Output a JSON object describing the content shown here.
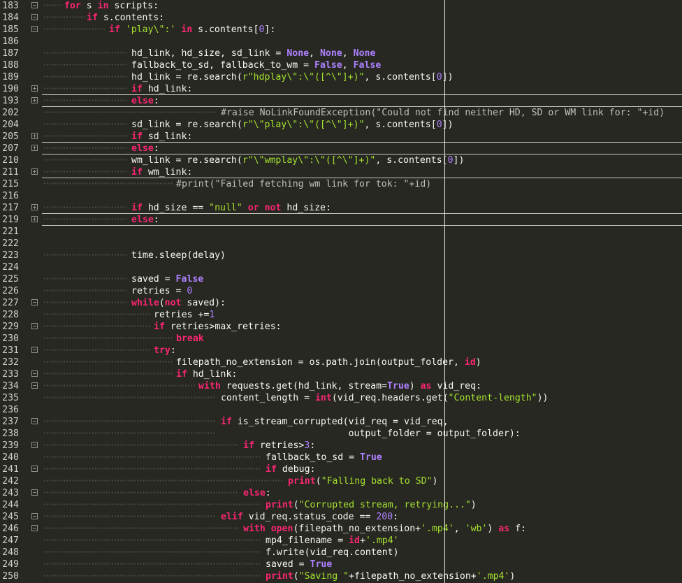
{
  "editor": {
    "ruler_column": 72,
    "lines": [
      {
        "n": "183",
        "fold": "minus",
        "indent": 1,
        "tokens": [
          [
            "for",
            "k"
          ],
          [
            " s ",
            ""
          ],
          [
            "in",
            "k"
          ],
          [
            " scripts:",
            ""
          ]
        ]
      },
      {
        "n": "184",
        "fold": "minus",
        "indent": 2,
        "tokens": [
          [
            "if",
            "k"
          ],
          [
            " s.contents:",
            ""
          ]
        ]
      },
      {
        "n": "185",
        "fold": "minus",
        "indent": 3,
        "tokens": [
          [
            "if",
            "k"
          ],
          [
            " ",
            ""
          ],
          [
            "'play\\\":'",
            "s"
          ],
          [
            " ",
            ""
          ],
          [
            "in",
            "k"
          ],
          [
            " s.contents[",
            ""
          ],
          [
            "0",
            "n"
          ],
          [
            "]:",
            ""
          ]
        ]
      },
      {
        "n": "186",
        "fold": "",
        "indent": 0,
        "tokens": []
      },
      {
        "n": "187",
        "fold": "",
        "indent": 4,
        "tokens": [
          [
            "hd_link, hd_size, sd_link = ",
            ""
          ],
          [
            "None",
            "b"
          ],
          [
            ", ",
            ""
          ],
          [
            "None",
            "b"
          ],
          [
            ", ",
            ""
          ],
          [
            "None",
            "b"
          ]
        ]
      },
      {
        "n": "188",
        "fold": "",
        "indent": 4,
        "tokens": [
          [
            "fallback_to_sd, fallback_to_wm = ",
            ""
          ],
          [
            "False",
            "b"
          ],
          [
            ", ",
            ""
          ],
          [
            "False",
            "b"
          ]
        ]
      },
      {
        "n": "189",
        "fold": "",
        "indent": 4,
        "tokens": [
          [
            "hd_link = re.search(",
            ""
          ],
          [
            "r\"hdplay\\\":\\\"([^\\\"]+)\"",
            "s"
          ],
          [
            ", s.contents[",
            ""
          ],
          [
            "0",
            "n"
          ],
          [
            "])",
            ""
          ]
        ]
      },
      {
        "n": "190",
        "fold": "plus",
        "indent": 4,
        "sep": true,
        "tokens": [
          [
            "if",
            "k"
          ],
          [
            " hd_link:",
            ""
          ]
        ]
      },
      {
        "n": "193",
        "fold": "plus",
        "indent": 4,
        "sep": true,
        "tokens": [
          [
            "else",
            "k"
          ],
          [
            ":",
            ""
          ]
        ]
      },
      {
        "n": "202",
        "fold": "",
        "indent": 8,
        "tokens": [
          [
            "#raise NoLinkFoundException(\"Could not find neither HD, SD or WM link for: \"+id)",
            "c"
          ]
        ]
      },
      {
        "n": "204",
        "fold": "",
        "indent": 4,
        "tokens": [
          [
            "sd_link = re.search(",
            ""
          ],
          [
            "r\"\\\"play\\\":\\\"([^\\\"]+)\"",
            "s"
          ],
          [
            ", s.contents[",
            ""
          ],
          [
            "0",
            "n"
          ],
          [
            "])",
            ""
          ]
        ]
      },
      {
        "n": "205",
        "fold": "plus",
        "indent": 4,
        "sep": true,
        "tokens": [
          [
            "if",
            "k"
          ],
          [
            " sd_link:",
            ""
          ]
        ]
      },
      {
        "n": "207",
        "fold": "plus",
        "indent": 4,
        "sep": true,
        "tokens": [
          [
            "else",
            "k"
          ],
          [
            ":",
            ""
          ]
        ]
      },
      {
        "n": "210",
        "fold": "",
        "indent": 4,
        "tokens": [
          [
            "wm_link = re.search(",
            ""
          ],
          [
            "r\"\\\"wmplay\\\":\\\"([^\\\"]+)\"",
            "s"
          ],
          [
            ", s.contents[",
            ""
          ],
          [
            "0",
            "n"
          ],
          [
            "])",
            ""
          ]
        ]
      },
      {
        "n": "211",
        "fold": "plus",
        "indent": 4,
        "sep": true,
        "tokens": [
          [
            "if",
            "k"
          ],
          [
            " wm_link:",
            ""
          ]
        ]
      },
      {
        "n": "215",
        "fold": "",
        "indent": 6,
        "tokens": [
          [
            "#print(\"Failed fetching wm link for tok: \"+id)",
            "c"
          ]
        ]
      },
      {
        "n": "216",
        "fold": "",
        "indent": 0,
        "tokens": []
      },
      {
        "n": "217",
        "fold": "plus",
        "indent": 4,
        "sep": true,
        "tokens": [
          [
            "if",
            "k"
          ],
          [
            " hd_size == ",
            ""
          ],
          [
            "\"null\"",
            "s"
          ],
          [
            " ",
            ""
          ],
          [
            "or",
            "k"
          ],
          [
            " ",
            ""
          ],
          [
            "not",
            "k"
          ],
          [
            " hd_size:",
            ""
          ]
        ]
      },
      {
        "n": "219",
        "fold": "plus",
        "indent": 4,
        "sep": true,
        "tokens": [
          [
            "else",
            "k"
          ],
          [
            ":",
            ""
          ]
        ]
      },
      {
        "n": "221",
        "fold": "",
        "indent": 0,
        "tokens": []
      },
      {
        "n": "222",
        "fold": "",
        "indent": 0,
        "tokens": []
      },
      {
        "n": "223",
        "fold": "",
        "indent": 4,
        "tokens": [
          [
            "time.sleep(delay)",
            ""
          ]
        ]
      },
      {
        "n": "224",
        "fold": "",
        "indent": 0,
        "tokens": []
      },
      {
        "n": "225",
        "fold": "",
        "indent": 4,
        "tokens": [
          [
            "saved = ",
            ""
          ],
          [
            "False",
            "b"
          ]
        ]
      },
      {
        "n": "226",
        "fold": "",
        "indent": 4,
        "tokens": [
          [
            "retries = ",
            ""
          ],
          [
            "0",
            "n"
          ]
        ]
      },
      {
        "n": "227",
        "fold": "minus",
        "indent": 4,
        "tokens": [
          [
            "while",
            "k"
          ],
          [
            "(",
            ""
          ],
          [
            "not",
            "k"
          ],
          [
            " saved):",
            ""
          ]
        ]
      },
      {
        "n": "228",
        "fold": "",
        "indent": 5,
        "tokens": [
          [
            "retries +=",
            ""
          ],
          [
            "1",
            "n"
          ]
        ]
      },
      {
        "n": "229",
        "fold": "minus",
        "indent": 5,
        "tokens": [
          [
            "if",
            "k"
          ],
          [
            " retries>max_retries:",
            ""
          ]
        ]
      },
      {
        "n": "230",
        "fold": "",
        "indent": 6,
        "tokens": [
          [
            "break",
            "k"
          ]
        ]
      },
      {
        "n": "231",
        "fold": "minus",
        "indent": 5,
        "tokens": [
          [
            "try",
            "k"
          ],
          [
            ":",
            ""
          ]
        ]
      },
      {
        "n": "232",
        "fold": "",
        "indent": 6,
        "tokens": [
          [
            "filepath_no_extension = os.path.join(output_folder, ",
            ""
          ],
          [
            "id",
            "f"
          ],
          [
            ")",
            ""
          ]
        ]
      },
      {
        "n": "233",
        "fold": "minus",
        "indent": 6,
        "tokens": [
          [
            "if",
            "k"
          ],
          [
            " hd_link:",
            ""
          ]
        ]
      },
      {
        "n": "234",
        "fold": "minus",
        "indent": 7,
        "tokens": [
          [
            "with",
            "k"
          ],
          [
            " requests.get(hd_link, stream=",
            ""
          ],
          [
            "True",
            "b"
          ],
          [
            ") ",
            ""
          ],
          [
            "as",
            "k"
          ],
          [
            " vid_req:",
            ""
          ]
        ]
      },
      {
        "n": "235",
        "fold": "",
        "indent": 8,
        "tokens": [
          [
            "content_length = ",
            ""
          ],
          [
            "int",
            "f"
          ],
          [
            "(vid_req.headers.get(",
            ""
          ],
          [
            "\"Content-length\"",
            "s"
          ],
          [
            "))",
            ""
          ]
        ]
      },
      {
        "n": "236",
        "fold": "",
        "indent": 0,
        "tokens": []
      },
      {
        "n": "237",
        "fold": "minus",
        "indent": 8,
        "tokens": [
          [
            "if",
            "k"
          ],
          [
            " is_stream_corrupted(vid_req = vid_req,",
            ""
          ]
        ]
      },
      {
        "n": "238",
        "fold": "",
        "indent": 8,
        "tokens": [
          [
            "                       output_folder = output_folder):",
            ""
          ]
        ]
      },
      {
        "n": "239",
        "fold": "minus",
        "indent": 9,
        "tokens": [
          [
            "if",
            "k"
          ],
          [
            " retries>",
            ""
          ],
          [
            "3",
            "n"
          ],
          [
            ":",
            ""
          ]
        ]
      },
      {
        "n": "240",
        "fold": "",
        "indent": 10,
        "tokens": [
          [
            "fallback_to_sd = ",
            ""
          ],
          [
            "True",
            "b"
          ]
        ]
      },
      {
        "n": "241",
        "fold": "minus",
        "indent": 10,
        "tokens": [
          [
            "if",
            "k"
          ],
          [
            " debug:",
            ""
          ]
        ]
      },
      {
        "n": "242",
        "fold": "",
        "indent": 11,
        "tokens": [
          [
            "print",
            "f"
          ],
          [
            "(",
            ""
          ],
          [
            "\"Falling back to SD\"",
            "s"
          ],
          [
            ")",
            ""
          ]
        ]
      },
      {
        "n": "243",
        "fold": "minus",
        "indent": 9,
        "tokens": [
          [
            "else",
            "k"
          ],
          [
            ":",
            ""
          ]
        ]
      },
      {
        "n": "244",
        "fold": "",
        "indent": 10,
        "tokens": [
          [
            "print",
            "f"
          ],
          [
            "(",
            ""
          ],
          [
            "\"Corrupted stream, retrying...\"",
            "s"
          ],
          [
            ")",
            ""
          ]
        ]
      },
      {
        "n": "245",
        "fold": "minus",
        "indent": 8,
        "tokens": [
          [
            "elif",
            "k"
          ],
          [
            " vid_req.status_code == ",
            ""
          ],
          [
            "200",
            "n"
          ],
          [
            ":",
            ""
          ]
        ]
      },
      {
        "n": "246",
        "fold": "minus",
        "indent": 9,
        "tokens": [
          [
            "with",
            "k"
          ],
          [
            " ",
            ""
          ],
          [
            "open",
            "f"
          ],
          [
            "(filepath_no_extension+",
            ""
          ],
          [
            "'.mp4'",
            "s"
          ],
          [
            ", ",
            ""
          ],
          [
            "'wb'",
            "s"
          ],
          [
            ") ",
            ""
          ],
          [
            "as",
            "k"
          ],
          [
            " f:",
            ""
          ]
        ]
      },
      {
        "n": "247",
        "fold": "",
        "indent": 10,
        "tokens": [
          [
            "mp4_filename = ",
            ""
          ],
          [
            "id",
            "f"
          ],
          [
            "+",
            ""
          ],
          [
            "'.mp4'",
            "s"
          ]
        ]
      },
      {
        "n": "248",
        "fold": "",
        "indent": 10,
        "tokens": [
          [
            "f.write(vid_req.content)",
            ""
          ]
        ]
      },
      {
        "n": "249",
        "fold": "",
        "indent": 10,
        "tokens": [
          [
            "saved = ",
            ""
          ],
          [
            "True",
            "b"
          ]
        ]
      },
      {
        "n": "250",
        "fold": "",
        "indent": 10,
        "tokens": [
          [
            "print",
            "f"
          ],
          [
            "(",
            ""
          ],
          [
            "\"Saving \"",
            "s"
          ],
          [
            "+filepath_no_extension+",
            ""
          ],
          [
            "'.mp4'",
            "s"
          ],
          [
            ")",
            ""
          ]
        ]
      }
    ]
  }
}
